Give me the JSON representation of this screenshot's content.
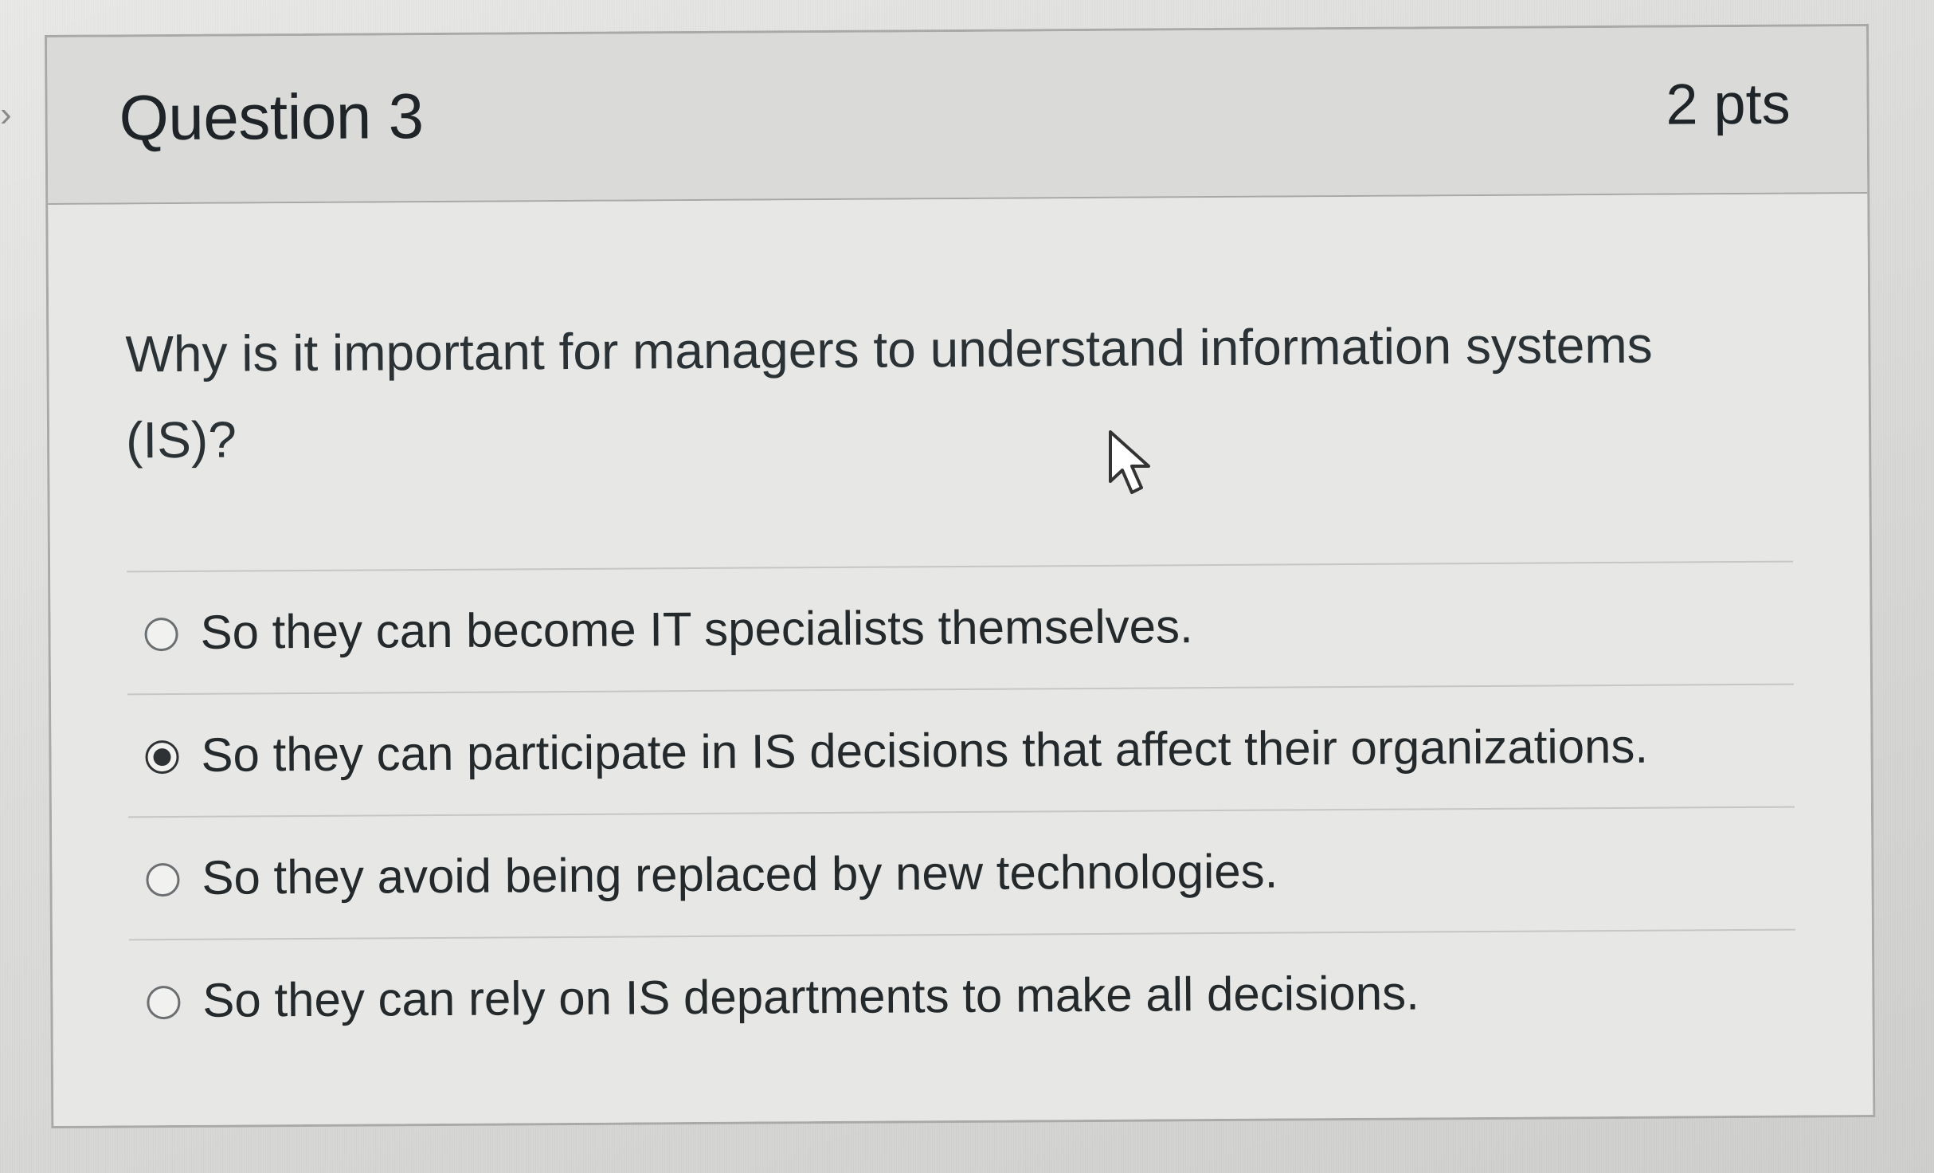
{
  "question": {
    "title": "Question 3",
    "points": "2 pts",
    "text": "Why is it important for managers to understand information systems (IS)?",
    "answers": [
      {
        "label": "So they can become IT specialists themselves.",
        "selected": false
      },
      {
        "label": "So they can participate in IS decisions that affect their organizations.",
        "selected": true
      },
      {
        "label": "So they avoid being replaced by new technologies.",
        "selected": false
      },
      {
        "label": "So they can rely on IS departments to make all decisions.",
        "selected": false
      }
    ]
  },
  "icons": {
    "cursor": "mouse-pointer-icon",
    "edge": "chevron-right-icon",
    "radio_selected": "radio-selected-icon",
    "radio_unselected": "radio-unselected-icon"
  },
  "colors": {
    "page_background": "#dcdcda",
    "card_background": "#e7e7e5",
    "header_background": "#dadad8",
    "border": "#a9aaa8",
    "text": "#24292c"
  }
}
